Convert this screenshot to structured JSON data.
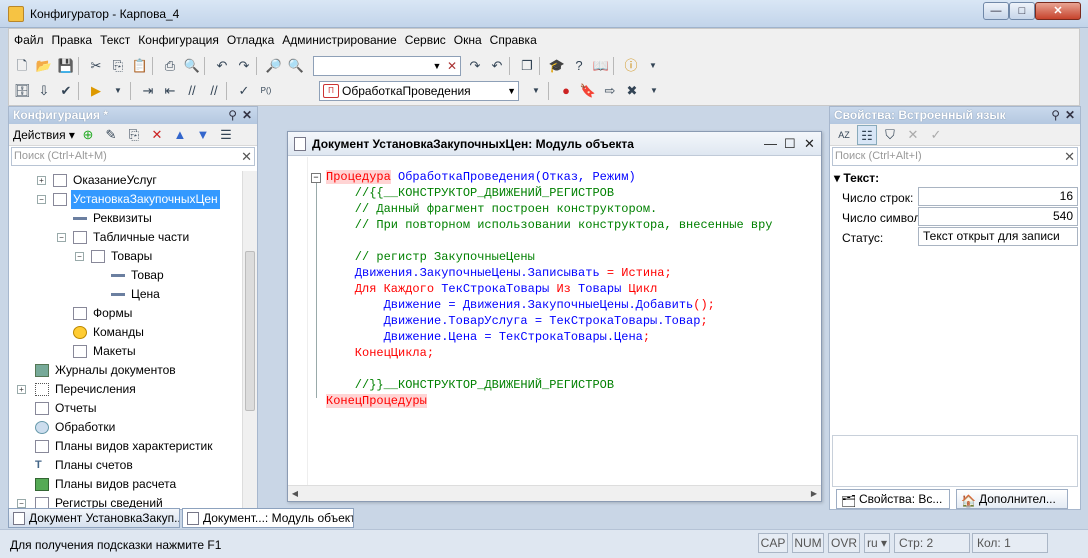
{
  "window": {
    "title": "Конфигуратор - Карпова_4",
    "min": "—",
    "max": "□",
    "close": "✕"
  },
  "menu": [
    "Файл",
    "Правка",
    "Текст",
    "Конфигурация",
    "Отладка",
    "Администрирование",
    "Сервис",
    "Окна",
    "Справка"
  ],
  "toolbar": {
    "search_value": "",
    "procedure_combo": "ОбработкаПроведения"
  },
  "left_panel": {
    "title": "Конфигурация *",
    "actions_label": "Действия",
    "filter_placeholder": "Поиск (Ctrl+Alt+M)",
    "tree": [
      {
        "label": "ОказаниеУслуг"
      },
      {
        "label": "УстановкаЗакупочныхЦен"
      },
      {
        "label": "Реквизиты"
      },
      {
        "label": "Табличные части"
      },
      {
        "label": "Товары"
      },
      {
        "label": "Товар"
      },
      {
        "label": "Цена"
      },
      {
        "label": "Формы"
      },
      {
        "label": "Команды"
      },
      {
        "label": "Макеты"
      },
      {
        "label": "Журналы документов"
      },
      {
        "label": "Перечисления"
      },
      {
        "label": "Отчеты"
      },
      {
        "label": "Обработки"
      },
      {
        "label": "Планы видов характеристик"
      },
      {
        "label": "Планы счетов"
      },
      {
        "label": "Планы видов расчета"
      },
      {
        "label": "Регистры сведений"
      }
    ]
  },
  "editor": {
    "title": "Документ УстановкаЗакупочныхЦен: Модуль объекта",
    "code": {
      "l1_kw": "Процедура",
      "l1_rest": " ОбработкаПроведения(Отказ, Режим)",
      "l2": "    //{{__КОНСТРУКТОР_ДВИЖЕНИЙ_РЕГИСТРОВ",
      "l3": "    // Данный фрагмент построен конструктором.",
      "l4": "    // При повторном использовании конструктора, внесенные вру",
      "l5": "    // регистр ЗакупочныеЦены",
      "l6_id": "    Движения.ЗакупочныеЦены.Записывать",
      "l6_op": " = ",
      "l6_kw": "Истина",
      "l6_end": ";",
      "l7_kw1": "    Для Каждого",
      "l7_id1": " ТекСтрокаТовары",
      "l7_kw2": " Из",
      "l7_id2": " Товары",
      "l7_kw3": " Цикл",
      "l8_id": "        Движение = Движения.ЗакупочныеЦены.Добавить",
      "l8_op": "();",
      "l9_id": "        Движение.ТоварУслуга = ТекСтрокаТовары.Товар",
      "l9_op": ";",
      "l10_id": "        Движение.Цена = ТекСтрокаТовары.Цена",
      "l10_op": ";",
      "l11_kw": "    КонецЦикла",
      "l11_op": ";",
      "l12": "    //}}__КОНСТРУКТОР_ДВИЖЕНИЙ_РЕГИСТРОВ",
      "l13_kw": "КонецПроцедуры"
    }
  },
  "right_panel": {
    "title": "Свойства: Встроенный язык",
    "filter_placeholder": "Поиск (Ctrl+Alt+I)",
    "group": "Текст:",
    "props": [
      {
        "label": "Число строк:",
        "value": "16"
      },
      {
        "label": "Число символов:",
        "value": "540"
      },
      {
        "label": "Статус:",
        "value": "Текст открыт для записи"
      }
    ],
    "tabs": [
      "Свойства: Вс...",
      "Дополнител..."
    ]
  },
  "window_tabs": [
    "Документ УстановкаЗакуп...",
    "Документ...: Модуль объекта"
  ],
  "status": {
    "hint": "Для получения подсказки нажмите F1",
    "cap": "CAP",
    "num": "NUM",
    "ovr": "OVR",
    "lang": "ru",
    "row": "Стр: 2",
    "col": "Кол: 1"
  }
}
